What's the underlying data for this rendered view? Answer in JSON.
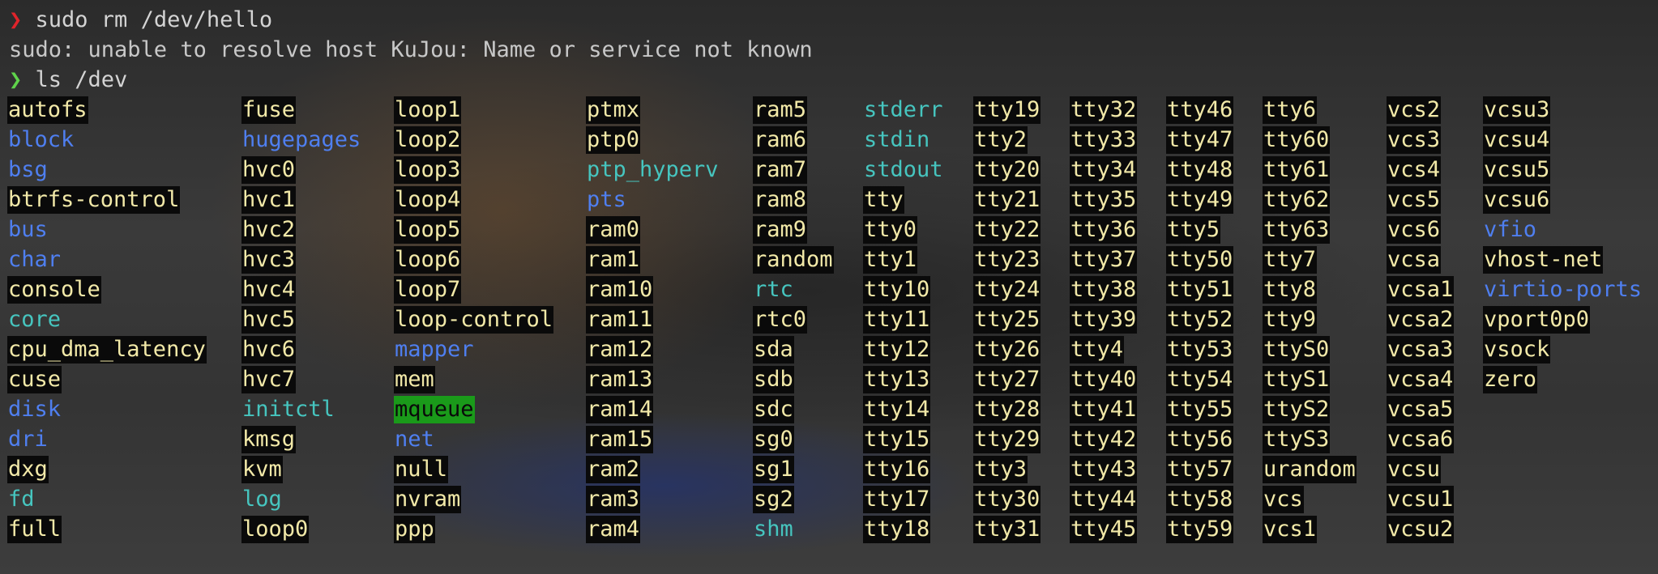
{
  "terminal": {
    "history_line_cutoff": "   ~",
    "prompt_symbol": "❯",
    "command1": " sudo rm /dev/hello",
    "error_line": "sudo: unable to resolve host KuJou: Name or service not known",
    "command2": " ls /dev",
    "colors": {
      "char_device_fg": "#f2e9a8",
      "char_device_bg": "#0a0a0a",
      "directory": "#4f7ff0",
      "symlink": "#46c5bf",
      "sticky_dir_bg": "#1a9a1a",
      "prompt_error": "#e0242b",
      "prompt_ok": "#5fd34b"
    },
    "columns": [
      [
        {
          "name": "autofs",
          "kind": "chr"
        },
        {
          "name": "block",
          "kind": "dir"
        },
        {
          "name": "bsg",
          "kind": "dir"
        },
        {
          "name": "btrfs-control",
          "kind": "chr"
        },
        {
          "name": "bus",
          "kind": "dir"
        },
        {
          "name": "char",
          "kind": "dir"
        },
        {
          "name": "console",
          "kind": "chr"
        },
        {
          "name": "core",
          "kind": "lnk"
        },
        {
          "name": "cpu_dma_latency",
          "kind": "chr"
        },
        {
          "name": "cuse",
          "kind": "chr"
        },
        {
          "name": "disk",
          "kind": "dir"
        },
        {
          "name": "dri",
          "kind": "dir"
        },
        {
          "name": "dxg",
          "kind": "chr"
        },
        {
          "name": "fd",
          "kind": "lnk"
        },
        {
          "name": "full",
          "kind": "chr"
        }
      ],
      [
        {
          "name": "fuse",
          "kind": "chr"
        },
        {
          "name": "hugepages",
          "kind": "dir"
        },
        {
          "name": "hvc0",
          "kind": "chr"
        },
        {
          "name": "hvc1",
          "kind": "chr"
        },
        {
          "name": "hvc2",
          "kind": "chr"
        },
        {
          "name": "hvc3",
          "kind": "chr"
        },
        {
          "name": "hvc4",
          "kind": "chr"
        },
        {
          "name": "hvc5",
          "kind": "chr"
        },
        {
          "name": "hvc6",
          "kind": "chr"
        },
        {
          "name": "hvc7",
          "kind": "chr"
        },
        {
          "name": "initctl",
          "kind": "lnk"
        },
        {
          "name": "kmsg",
          "kind": "chr"
        },
        {
          "name": "kvm",
          "kind": "chr"
        },
        {
          "name": "log",
          "kind": "lnk"
        },
        {
          "name": "loop0",
          "kind": "chr"
        }
      ],
      [
        {
          "name": "loop1",
          "kind": "chr"
        },
        {
          "name": "loop2",
          "kind": "chr"
        },
        {
          "name": "loop3",
          "kind": "chr"
        },
        {
          "name": "loop4",
          "kind": "chr"
        },
        {
          "name": "loop5",
          "kind": "chr"
        },
        {
          "name": "loop6",
          "kind": "chr"
        },
        {
          "name": "loop7",
          "kind": "chr"
        },
        {
          "name": "loop-control",
          "kind": "chr"
        },
        {
          "name": "mapper",
          "kind": "dir"
        },
        {
          "name": "mem",
          "kind": "chr"
        },
        {
          "name": "mqueue",
          "kind": "sticky"
        },
        {
          "name": "net",
          "kind": "dir"
        },
        {
          "name": "null",
          "kind": "chr"
        },
        {
          "name": "nvram",
          "kind": "chr"
        },
        {
          "name": "ppp",
          "kind": "chr"
        }
      ],
      [
        {
          "name": "ptmx",
          "kind": "chr"
        },
        {
          "name": "ptp0",
          "kind": "chr"
        },
        {
          "name": "ptp_hyperv",
          "kind": "lnk"
        },
        {
          "name": "pts",
          "kind": "dir"
        },
        {
          "name": "ram0",
          "kind": "chr"
        },
        {
          "name": "ram1",
          "kind": "chr"
        },
        {
          "name": "ram10",
          "kind": "chr"
        },
        {
          "name": "ram11",
          "kind": "chr"
        },
        {
          "name": "ram12",
          "kind": "chr"
        },
        {
          "name": "ram13",
          "kind": "chr"
        },
        {
          "name": "ram14",
          "kind": "chr"
        },
        {
          "name": "ram15",
          "kind": "chr"
        },
        {
          "name": "ram2",
          "kind": "chr"
        },
        {
          "name": "ram3",
          "kind": "chr"
        },
        {
          "name": "ram4",
          "kind": "chr"
        }
      ],
      [
        {
          "name": "ram5",
          "kind": "chr"
        },
        {
          "name": "ram6",
          "kind": "chr"
        },
        {
          "name": "ram7",
          "kind": "chr"
        },
        {
          "name": "ram8",
          "kind": "chr"
        },
        {
          "name": "ram9",
          "kind": "chr"
        },
        {
          "name": "random",
          "kind": "chr"
        },
        {
          "name": "rtc",
          "kind": "lnk"
        },
        {
          "name": "rtc0",
          "kind": "chr"
        },
        {
          "name": "sda",
          "kind": "chr"
        },
        {
          "name": "sdb",
          "kind": "chr"
        },
        {
          "name": "sdc",
          "kind": "chr"
        },
        {
          "name": "sg0",
          "kind": "chr"
        },
        {
          "name": "sg1",
          "kind": "chr"
        },
        {
          "name": "sg2",
          "kind": "chr"
        },
        {
          "name": "shm",
          "kind": "lnk"
        }
      ],
      [
        {
          "name": "stderr",
          "kind": "lnk"
        },
        {
          "name": "stdin",
          "kind": "lnk"
        },
        {
          "name": "stdout",
          "kind": "lnk"
        },
        {
          "name": "tty",
          "kind": "chr"
        },
        {
          "name": "tty0",
          "kind": "chr"
        },
        {
          "name": "tty1",
          "kind": "chr"
        },
        {
          "name": "tty10",
          "kind": "chr"
        },
        {
          "name": "tty11",
          "kind": "chr"
        },
        {
          "name": "tty12",
          "kind": "chr"
        },
        {
          "name": "tty13",
          "kind": "chr"
        },
        {
          "name": "tty14",
          "kind": "chr"
        },
        {
          "name": "tty15",
          "kind": "chr"
        },
        {
          "name": "tty16",
          "kind": "chr"
        },
        {
          "name": "tty17",
          "kind": "chr"
        },
        {
          "name": "tty18",
          "kind": "chr"
        }
      ],
      [
        {
          "name": "tty19",
          "kind": "chr"
        },
        {
          "name": "tty2",
          "kind": "chr"
        },
        {
          "name": "tty20",
          "kind": "chr"
        },
        {
          "name": "tty21",
          "kind": "chr"
        },
        {
          "name": "tty22",
          "kind": "chr"
        },
        {
          "name": "tty23",
          "kind": "chr"
        },
        {
          "name": "tty24",
          "kind": "chr"
        },
        {
          "name": "tty25",
          "kind": "chr"
        },
        {
          "name": "tty26",
          "kind": "chr"
        },
        {
          "name": "tty27",
          "kind": "chr"
        },
        {
          "name": "tty28",
          "kind": "chr"
        },
        {
          "name": "tty29",
          "kind": "chr"
        },
        {
          "name": "tty3",
          "kind": "chr"
        },
        {
          "name": "tty30",
          "kind": "chr"
        },
        {
          "name": "tty31",
          "kind": "chr"
        }
      ],
      [
        {
          "name": "tty32",
          "kind": "chr"
        },
        {
          "name": "tty33",
          "kind": "chr"
        },
        {
          "name": "tty34",
          "kind": "chr"
        },
        {
          "name": "tty35",
          "kind": "chr"
        },
        {
          "name": "tty36",
          "kind": "chr"
        },
        {
          "name": "tty37",
          "kind": "chr"
        },
        {
          "name": "tty38",
          "kind": "chr"
        },
        {
          "name": "tty39",
          "kind": "chr"
        },
        {
          "name": "tty4",
          "kind": "chr"
        },
        {
          "name": "tty40",
          "kind": "chr"
        },
        {
          "name": "tty41",
          "kind": "chr"
        },
        {
          "name": "tty42",
          "kind": "chr"
        },
        {
          "name": "tty43",
          "kind": "chr"
        },
        {
          "name": "tty44",
          "kind": "chr"
        },
        {
          "name": "tty45",
          "kind": "chr"
        }
      ],
      [
        {
          "name": "tty46",
          "kind": "chr"
        },
        {
          "name": "tty47",
          "kind": "chr"
        },
        {
          "name": "tty48",
          "kind": "chr"
        },
        {
          "name": "tty49",
          "kind": "chr"
        },
        {
          "name": "tty5",
          "kind": "chr"
        },
        {
          "name": "tty50",
          "kind": "chr"
        },
        {
          "name": "tty51",
          "kind": "chr"
        },
        {
          "name": "tty52",
          "kind": "chr"
        },
        {
          "name": "tty53",
          "kind": "chr"
        },
        {
          "name": "tty54",
          "kind": "chr"
        },
        {
          "name": "tty55",
          "kind": "chr"
        },
        {
          "name": "tty56",
          "kind": "chr"
        },
        {
          "name": "tty57",
          "kind": "chr"
        },
        {
          "name": "tty58",
          "kind": "chr"
        },
        {
          "name": "tty59",
          "kind": "chr"
        }
      ],
      [
        {
          "name": "tty6",
          "kind": "chr"
        },
        {
          "name": "tty60",
          "kind": "chr"
        },
        {
          "name": "tty61",
          "kind": "chr"
        },
        {
          "name": "tty62",
          "kind": "chr"
        },
        {
          "name": "tty63",
          "kind": "chr"
        },
        {
          "name": "tty7",
          "kind": "chr"
        },
        {
          "name": "tty8",
          "kind": "chr"
        },
        {
          "name": "tty9",
          "kind": "chr"
        },
        {
          "name": "ttyS0",
          "kind": "chr"
        },
        {
          "name": "ttyS1",
          "kind": "chr"
        },
        {
          "name": "ttyS2",
          "kind": "chr"
        },
        {
          "name": "ttyS3",
          "kind": "chr"
        },
        {
          "name": "urandom",
          "kind": "chr"
        },
        {
          "name": "vcs",
          "kind": "chr"
        },
        {
          "name": "vcs1",
          "kind": "chr"
        }
      ],
      [
        {
          "name": "vcs2",
          "kind": "chr"
        },
        {
          "name": "vcs3",
          "kind": "chr"
        },
        {
          "name": "vcs4",
          "kind": "chr"
        },
        {
          "name": "vcs5",
          "kind": "chr"
        },
        {
          "name": "vcs6",
          "kind": "chr"
        },
        {
          "name": "vcsa",
          "kind": "chr"
        },
        {
          "name": "vcsa1",
          "kind": "chr"
        },
        {
          "name": "vcsa2",
          "kind": "chr"
        },
        {
          "name": "vcsa3",
          "kind": "chr"
        },
        {
          "name": "vcsa4",
          "kind": "chr"
        },
        {
          "name": "vcsa5",
          "kind": "chr"
        },
        {
          "name": "vcsa6",
          "kind": "chr"
        },
        {
          "name": "vcsu",
          "kind": "chr"
        },
        {
          "name": "vcsu1",
          "kind": "chr"
        },
        {
          "name": "vcsu2",
          "kind": "chr"
        }
      ],
      [
        {
          "name": "vcsu3",
          "kind": "chr"
        },
        {
          "name": "vcsu4",
          "kind": "chr"
        },
        {
          "name": "vcsu5",
          "kind": "chr"
        },
        {
          "name": "vcsu6",
          "kind": "chr"
        },
        {
          "name": "vfio",
          "kind": "dir"
        },
        {
          "name": "vhost-net",
          "kind": "chr"
        },
        {
          "name": "virtio-ports",
          "kind": "dir"
        },
        {
          "name": "vport0p0",
          "kind": "chr"
        },
        {
          "name": "vsock",
          "kind": "chr"
        },
        {
          "name": "zero",
          "kind": "chr"
        }
      ]
    ]
  }
}
